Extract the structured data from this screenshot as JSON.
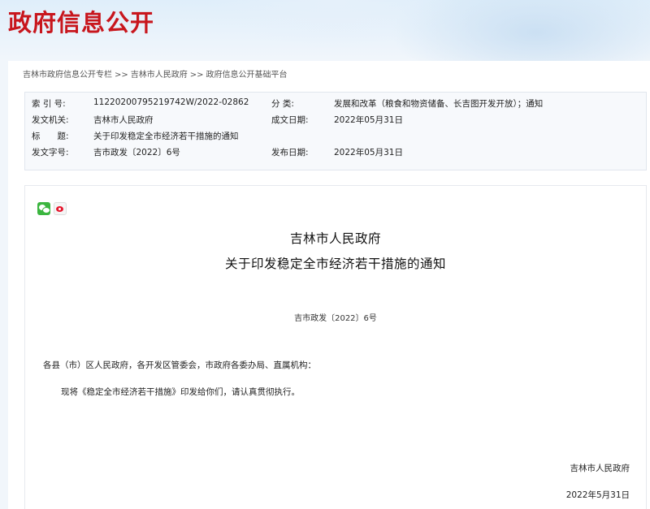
{
  "header": {
    "site_title": "政府信息公开"
  },
  "breadcrumb": {
    "items": [
      "吉林市政府信息公开专栏",
      "吉林市人民政府",
      "政府信息公开基础平台"
    ],
    "separator": ">>"
  },
  "info": {
    "index_label": "索 引 号:",
    "index_value": "11220200795219742W/2022-02862",
    "category_label": "分 类:",
    "category_value": "发展和改革（粮食和物资储备、长吉图开发开放）；通知",
    "issuer_label": "发文机关:",
    "issuer_value": "吉林市人民政府",
    "created_label": "成文日期:",
    "created_value": "2022年05月31日",
    "title_label": "标　　题:",
    "title_value": "关于印发稳定全市经济若干措施的通知",
    "doc_no_label": "发文字号:",
    "doc_no_value": "吉市政发〔2022〕6号",
    "published_label": "发布日期:",
    "published_value": "2022年05月31日"
  },
  "share": {
    "icons": [
      "wechat-icon",
      "weibo-icon"
    ]
  },
  "document": {
    "org": "吉林市人民政府",
    "title": "关于印发稳定全市经济若干措施的通知",
    "number": "吉市政发〔2022〕6号",
    "salutation": "各县（市）区人民政府，各开发区管委会，市政府各委办局、直属机构：",
    "body": "现将《稳定全市经济若干措施》印发给你们，请认真贯彻执行。",
    "sign_org": "吉林市人民政府",
    "sign_date": "2022年5月31日"
  },
  "colors": {
    "title_red": "#c8161d",
    "page_bg": "#f1f6fb",
    "info_bg": "#f7f9fc"
  }
}
